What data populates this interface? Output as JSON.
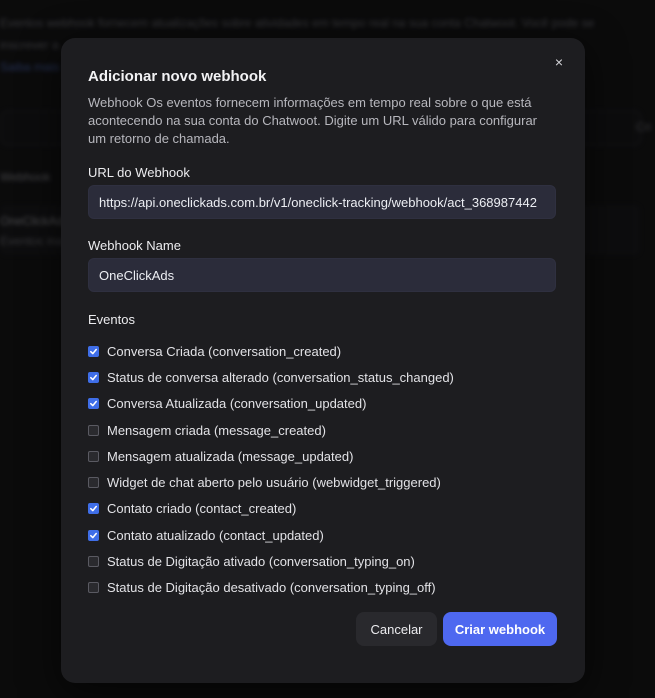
{
  "background": {
    "description_line1": "Eventos webhook fornecem atualizações sobre atividades em tempo real na sua conta Chatwoot. Você pode se",
    "description_line2": "inscrever a",
    "link": "Saiba mais",
    "section_title": "Webhook",
    "row_text1": "OneClickAds",
    "row_text2": "Eventos ina",
    "right_fragment": "Cri"
  },
  "modal": {
    "title": "Adicionar novo webhook",
    "description": "Webhook Os eventos fornecem informações em tempo real sobre o que está acontecendo na sua conta do Chatwoot. Digite um URL válido para configurar um retorno de chamada.",
    "close_icon": "×",
    "url_label": "URL do Webhook",
    "url_value": "https://api.oneclickads.com.br/v1/oneclick-tracking/webhook/act_368987442",
    "name_label": "Webhook Name",
    "name_value": "OneClickAds",
    "events_label": "Eventos",
    "events": [
      {
        "label": "Conversa Criada (conversation_created)",
        "checked": true
      },
      {
        "label": "Status de conversa alterado (conversation_status_changed)",
        "checked": true
      },
      {
        "label": "Conversa Atualizada (conversation_updated)",
        "checked": true
      },
      {
        "label": "Mensagem criada (message_created)",
        "checked": false
      },
      {
        "label": "Mensagem atualizada (message_updated)",
        "checked": false
      },
      {
        "label": "Widget de chat aberto pelo usuário (webwidget_triggered)",
        "checked": false
      },
      {
        "label": "Contato criado (contact_created)",
        "checked": true
      },
      {
        "label": "Contato atualizado (contact_updated)",
        "checked": true
      },
      {
        "label": "Status de Digitação ativado (conversation_typing_on)",
        "checked": false
      },
      {
        "label": "Status de Digitação desativado (conversation_typing_off)",
        "checked": false
      }
    ],
    "cancel_label": "Cancelar",
    "create_label": "Criar webhook"
  },
  "colors": {
    "accent": "#4e68f0",
    "checkbox_on": "#3f6ee8",
    "modal_bg": "#1d1d20",
    "input_bg": "#2b2c3a"
  }
}
